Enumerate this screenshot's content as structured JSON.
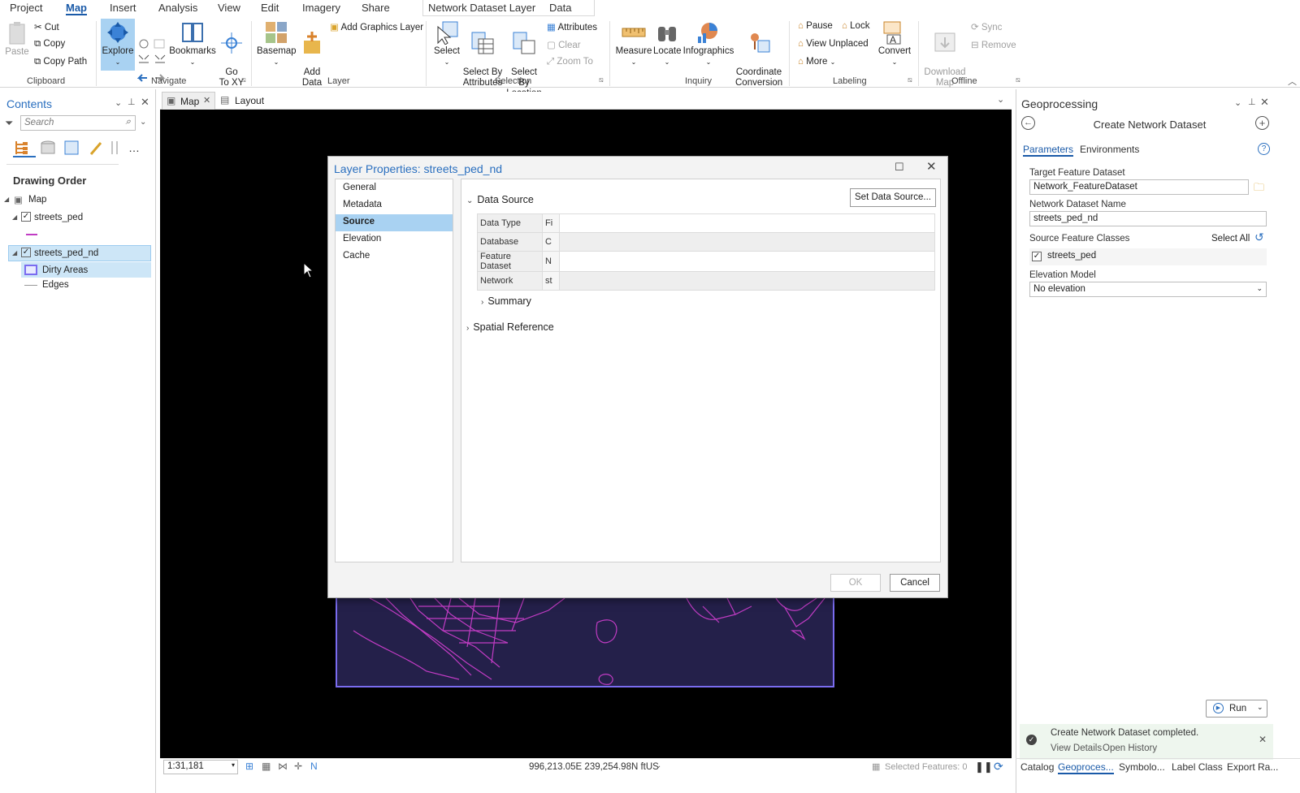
{
  "ribbon_tabs": [
    "Project",
    "Map",
    "Insert",
    "Analysis",
    "View",
    "Edit",
    "Imagery",
    "Share",
    "Network Dataset Layer",
    "Data"
  ],
  "active_tab": "Map",
  "ribbon": {
    "paste": "Paste",
    "cut": "Cut",
    "copy": "Copy",
    "copy_path": "Copy Path",
    "clipboard": "Clipboard",
    "explore": "Explore",
    "bookmarks": "Bookmarks",
    "go_to_xy": "Go\nTo XY",
    "navigate": "Navigate",
    "basemap": "Basemap",
    "add_data": "Add\nData",
    "add_graphics_layer": "Add Graphics Layer",
    "layer": "Layer",
    "select": "Select",
    "select_by_attributes": "Select By\nAttributes",
    "select_by_location": "Select By\nLocation",
    "attributes": "Attributes",
    "clear": "Clear",
    "zoom_to": "Zoom To",
    "selection": "Selection",
    "measure": "Measure",
    "locate": "Locate",
    "infographics": "Infographics",
    "coordinate_conversion": "Coordinate\nConversion",
    "inquiry": "Inquiry",
    "pause": "Pause",
    "lock": "Lock",
    "view_unplaced": "View Unplaced",
    "more": "More",
    "convert": "Convert",
    "labeling": "Labeling",
    "download_map": "Download\nMap",
    "sync": "Sync",
    "remove": "Remove",
    "offline": "Offline"
  },
  "contents": {
    "title": "Contents",
    "search_placeholder": "Search",
    "drawing_order": "Drawing Order",
    "map": "Map",
    "layer1": "streets_ped",
    "layer2": "streets_ped_nd",
    "dirty_areas": "Dirty Areas",
    "edges": "Edges"
  },
  "doc_tabs": {
    "map": "Map",
    "layout": "Layout"
  },
  "dialog": {
    "title": "Layer Properties: streets_ped_nd",
    "nav": [
      "General",
      "Metadata",
      "Source",
      "Elevation",
      "Cache"
    ],
    "selected_nav": "Source",
    "data_source": "Data Source",
    "set_data_source": "Set Data Source...",
    "rows": [
      {
        "key": "Data Type",
        "val": "Fi"
      },
      {
        "key": "Database",
        "val": "C"
      },
      {
        "key": "Feature Dataset",
        "val": "N"
      },
      {
        "key": "Network",
        "val": "st"
      }
    ],
    "summary": "Summary",
    "spatial_reference": "Spatial Reference",
    "ok": "OK",
    "cancel": "Cancel"
  },
  "status": {
    "scale": "1:31,181",
    "coords": "996,213.05E 239,254.98N ftUS",
    "selected_features": "Selected Features: 0"
  },
  "geo": {
    "title": "Geoprocessing",
    "tool_title": "Create Network Dataset",
    "tab_params": "Parameters",
    "tab_env": "Environments",
    "target_label": "Target Feature Dataset",
    "target_value": "Network_FeatureDataset",
    "name_label": "Network Dataset Name",
    "name_value": "streets_ped_nd",
    "source_label": "Source Feature Classes",
    "select_all": "Select All",
    "source_item": "streets_ped",
    "elev_label": "Elevation Model",
    "elev_value": "No elevation",
    "run": "Run",
    "completed": "Create Network Dataset completed.",
    "view_details": "View Details",
    "open_history": "Open History"
  },
  "bottom_tabs": [
    "Catalog",
    "Geoproces...",
    "Symbolo...",
    "Label Class",
    "Export Ra..."
  ],
  "colors": {
    "accent": "#2a6fbf",
    "selection": "#a9d2f2",
    "map_bg": "#000000",
    "inset_bg": "#24204a",
    "street": "#c13cc4"
  }
}
